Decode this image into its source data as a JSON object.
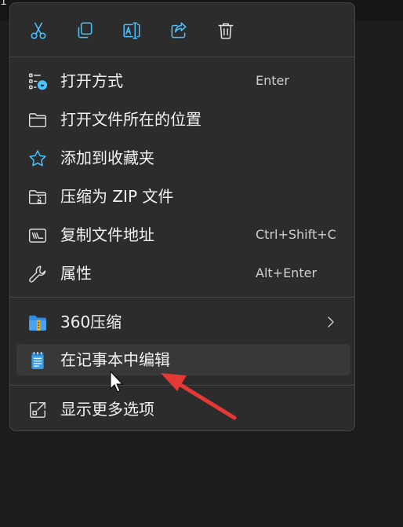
{
  "window": {
    "topbar_text": "1"
  },
  "toolbar": {
    "cut_icon": "scissors-icon",
    "copy_icon": "copy-icon",
    "rename_icon": "rename-icon",
    "share_icon": "share-icon",
    "delete_icon": "trash-icon"
  },
  "menu": {
    "items": [
      {
        "label": "打开方式",
        "shortcut": "Enter",
        "icon": "open-with-icon"
      },
      {
        "label": "打开文件所在的位置",
        "shortcut": "",
        "icon": "folder-icon"
      },
      {
        "label": "添加到收藏夹",
        "shortcut": "",
        "icon": "star-icon"
      },
      {
        "label": "压缩为 ZIP 文件",
        "shortcut": "",
        "icon": "zip-folder-icon"
      },
      {
        "label": "复制文件地址",
        "shortcut": "Ctrl+Shift+C",
        "icon": "copy-path-icon"
      },
      {
        "label": "属性",
        "shortcut": "Alt+Enter",
        "icon": "wrench-icon"
      },
      {
        "label": "360压缩",
        "shortcut": "",
        "icon": "360-zip-icon",
        "has_submenu": true
      },
      {
        "label": "在记事本中编辑",
        "shortcut": "",
        "icon": "notepad-icon",
        "highlighted": true
      },
      {
        "label": "显示更多选项",
        "shortcut": "",
        "icon": "more-options-icon"
      }
    ]
  },
  "colors": {
    "menu_bg": "#2c2c2c",
    "highlight_bg": "#383838",
    "text": "#f2f2f2",
    "shortcut_text": "#cfcfcf",
    "accent_blue": "#4cc2ff",
    "annotation_arrow": "#e53935"
  }
}
